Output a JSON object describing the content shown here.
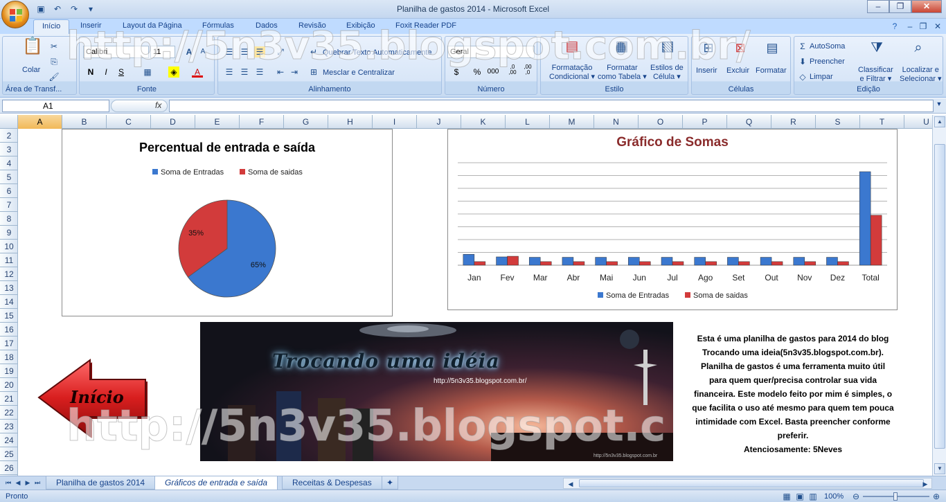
{
  "window": {
    "title": "Planilha de gastos 2014 - Microsoft Excel",
    "controls": {
      "minimize": "–",
      "maximize": "❐",
      "close": "✕"
    }
  },
  "ribbon_tabs": [
    "Início",
    "Inserir",
    "Layout da Página",
    "Fórmulas",
    "Dados",
    "Revisão",
    "Exibição",
    "Foxit Reader PDF"
  ],
  "ribbon": {
    "clipboard": {
      "label": "Área de Transf...",
      "paste": "Colar"
    },
    "font": {
      "label": "Fonte",
      "font_name": "Calibri",
      "font_size": "11",
      "bold": "N",
      "italic": "I",
      "underline": "S"
    },
    "alignment": {
      "label": "Alinhamento",
      "wrap_text": "Quebrar Texto Automaticamente",
      "merge_center": "Mesclar e Centralizar"
    },
    "number": {
      "label": "Número",
      "format": "Geral",
      "currency": "$",
      "percent": "%",
      "thousands": "000",
      "inc_decimal": ",0 ,00",
      "dec_decimal": ",00 ,0"
    },
    "styles": {
      "label": "Estilo",
      "conditional_line1": "Formatação",
      "conditional_line2": "Condicional",
      "table_line1": "Formatar",
      "table_line2": "como Tabela",
      "cell_line1": "Estilos de",
      "cell_line2": "Célula"
    },
    "cells": {
      "label": "Células",
      "insert": "Inserir",
      "delete": "Excluir",
      "format": "Formatar"
    },
    "editing": {
      "label": "Edição",
      "autosum": "AutoSoma",
      "fill": "Preencher",
      "clear": "Limpar",
      "sort_line1": "Classificar",
      "sort_line2": "e Filtrar",
      "find_line1": "Localizar e",
      "find_line2": "Selecionar"
    }
  },
  "formula_bar": {
    "name_box": "A1",
    "fx": "fx",
    "formula": ""
  },
  "columns": [
    "A",
    "B",
    "C",
    "D",
    "E",
    "F",
    "G",
    "H",
    "I",
    "J",
    "K",
    "L",
    "M",
    "N",
    "O",
    "P",
    "Q",
    "R",
    "S",
    "T",
    "U"
  ],
  "rows": [
    "2",
    "3",
    "4",
    "5",
    "6",
    "7",
    "8",
    "9",
    "10",
    "11",
    "12",
    "13",
    "14",
    "15",
    "16",
    "17",
    "18",
    "19",
    "20",
    "21",
    "22",
    "23",
    "24",
    "25",
    "26"
  ],
  "chart_data": [
    {
      "type": "pie",
      "title": "Percentual de entrada e saída",
      "legend": "top",
      "series": [
        {
          "name": "Soma de Entradas",
          "value": 65,
          "label": "65%",
          "color": "#3b78cf"
        },
        {
          "name": "Soma de saidas",
          "value": 35,
          "label": "35%",
          "color": "#d23b3b"
        }
      ]
    },
    {
      "type": "bar",
      "title": "Gráfico de Somas",
      "legend": "bottom",
      "grid": true,
      "categories": [
        "Jan",
        "Fev",
        "Mar",
        "Abr",
        "Mai",
        "Jun",
        "Jul",
        "Ago",
        "Set",
        "Out",
        "Nov",
        "Dez",
        "Total"
      ],
      "ylim": [
        0,
        8
      ],
      "series": [
        {
          "name": "Soma de Entradas",
          "color": "#3b78cf",
          "values": [
            0.85,
            0.65,
            0.62,
            0.62,
            0.62,
            0.62,
            0.62,
            0.62,
            0.62,
            0.62,
            0.62,
            0.62,
            7.3
          ]
        },
        {
          "name": "Soma de saidas",
          "color": "#d23b3b",
          "values": [
            0.28,
            0.7,
            0.28,
            0.28,
            0.28,
            0.28,
            0.28,
            0.28,
            0.28,
            0.28,
            0.28,
            0.28,
            3.9
          ]
        }
      ]
    }
  ],
  "banner": {
    "title": "Trocando uma idéia",
    "url": "http://5n3v35.blogspot.com.br/",
    "url_small": "http://5n3v35.blogspot.com.br"
  },
  "description": [
    "Esta é uma planilha de gastos para 2014 do blog",
    "Trocando uma ideia(5n3v35.blogspot.com.br).",
    "Planilha de gastos é uma ferramenta muito útil",
    "para quem quer/precisa controlar sua vida",
    "financeira. Este modelo feito por mim é simples, o",
    "que facilita o uso até mesmo para quem tem pouca",
    "intimidade com Excel. Basta preencher conforme",
    "preferir.",
    "Atenciosamente: 5Neves"
  ],
  "arrow_button": {
    "label": "Início",
    "color": "#d81e1e"
  },
  "watermark": {
    "top": "http://5n3v35.blogspot.com.br/",
    "bottom": "http://5n3v35.blogspot.c"
  },
  "sheet_tabs": [
    {
      "label": "Planilha de gastos 2014",
      "active": false
    },
    {
      "label": "Gráficos de entrada e saída",
      "active": true
    },
    {
      "label": "Receitas & Despesas",
      "active": false
    }
  ],
  "status": {
    "text": "Pronto",
    "zoom": "100%"
  }
}
